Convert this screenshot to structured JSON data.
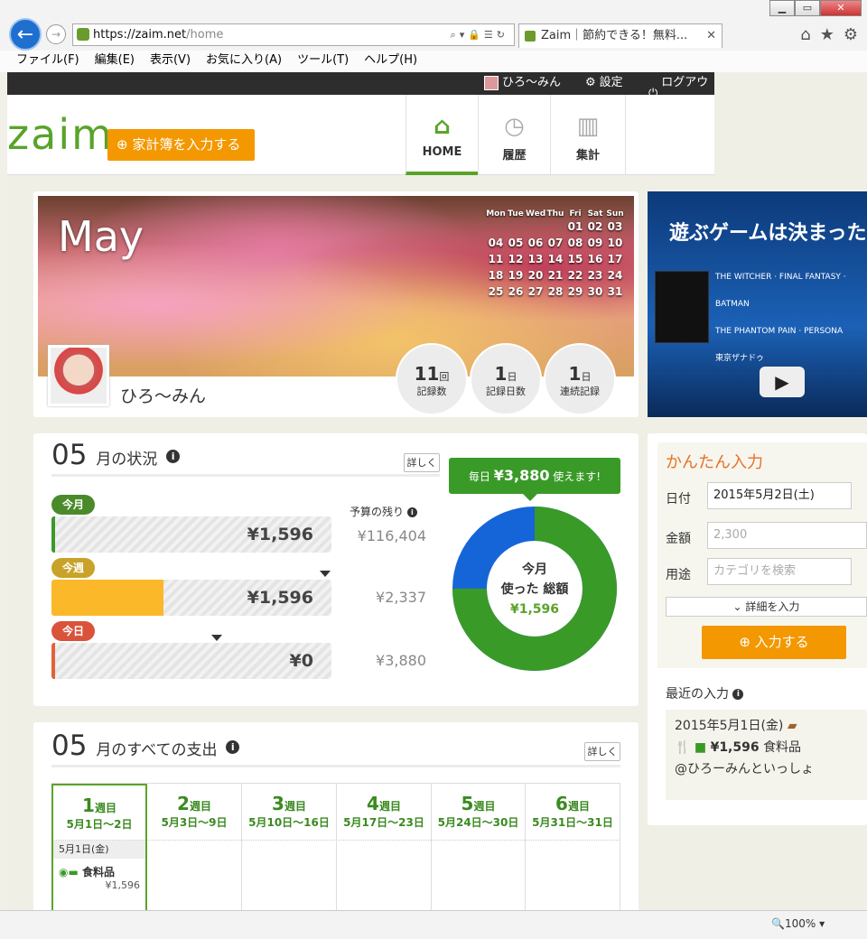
{
  "browser": {
    "url_host": "https://zaim.net",
    "url_path": "/home",
    "tab_title": "Zaim｜節約できる！無料...",
    "close_glyph": "✕",
    "menu": [
      "ファイル(F)",
      "編集(E)",
      "表示(V)",
      "お気に入り(A)",
      "ツール(T)",
      "ヘルプ(H)"
    ],
    "zoom": "100%"
  },
  "topbar": {
    "user": "ひろ〜みん",
    "settings": "設定",
    "logout": "ログアウト"
  },
  "header": {
    "logo": "zaim",
    "input_button": "家計簿を入力する",
    "nav": [
      {
        "label": "HOME",
        "icon": "home-icon",
        "active": true
      },
      {
        "label": "履歴",
        "icon": "clock-icon"
      },
      {
        "label": "集計",
        "icon": "chart-icon"
      }
    ]
  },
  "profile": {
    "month": "May",
    "username": "ひろ〜みん",
    "calendar": {
      "days": [
        "Mon",
        "Tue",
        "Wed",
        "Thu",
        "Fri",
        "Sat",
        "Sun"
      ],
      "weeks": [
        [
          "",
          "",
          "",
          "",
          "01",
          "02",
          "03"
        ],
        [
          "04",
          "05",
          "06",
          "07",
          "08",
          "09",
          "10"
        ],
        [
          "11",
          "12",
          "13",
          "14",
          "15",
          "16",
          "17"
        ],
        [
          "18",
          "19",
          "20",
          "21",
          "22",
          "23",
          "24"
        ],
        [
          "25",
          "26",
          "27",
          "28",
          "29",
          "30",
          "31"
        ]
      ]
    },
    "stats": [
      {
        "value": "11",
        "unit": "回",
        "label": "記録数"
      },
      {
        "value": "1",
        "unit": "日",
        "label": "記録日数"
      },
      {
        "value": "1",
        "unit": "日",
        "label": "連続記録"
      }
    ]
  },
  "ad": {
    "headline": "遊ぶゲームは決まった",
    "logos": [
      "THE WITCHER",
      "FINAL FANTASY",
      "BATMAN",
      "THE PHANTOM PAIN",
      "PERSONA",
      "東京ザナドゥ"
    ]
  },
  "status": {
    "month_num": "05",
    "title": "月の状況",
    "detail": "詳しく",
    "budget_label": "予算の残り",
    "callout_prefix": "毎日",
    "callout_amount": "¥3,880",
    "callout_suffix": "使えます!",
    "bars": [
      {
        "pill": "今月",
        "value": "¥1,596",
        "remaining": "¥116,404",
        "fill": 0.012,
        "color": "#4a8a2a",
        "fillcolor": "#3a9a28"
      },
      {
        "pill": "今週",
        "value": "¥1,596",
        "remaining": "¥2,337",
        "fill": 0.4,
        "color": "#c9a22a",
        "fillcolor": "#fbb829"
      },
      {
        "pill": "今日",
        "value": "¥0",
        "remaining": "¥3,880",
        "fill": 0.01,
        "color": "#d9533a",
        "fillcolor": "#e0633a"
      }
    ],
    "donut": {
      "line1": "今月",
      "line2": "使った 総額",
      "amount": "¥1,596",
      "used_fraction": 0.75,
      "used_color": "#3a9a28",
      "other_color": "#1565d8"
    }
  },
  "monthly": {
    "month_num": "05",
    "title": "月のすべての支出",
    "detail": "詳しく",
    "weeks": [
      {
        "n": "1",
        "w": "週目",
        "range": "5月1日〜2日"
      },
      {
        "n": "2",
        "w": "週目",
        "range": "5月3日〜9日"
      },
      {
        "n": "3",
        "w": "週目",
        "range": "5月10日〜16日"
      },
      {
        "n": "4",
        "w": "週目",
        "range": "5月17日〜23日"
      },
      {
        "n": "5",
        "w": "週目",
        "range": "5月24日〜30日"
      },
      {
        "n": "6",
        "w": "週目",
        "range": "5月31日〜31日"
      }
    ],
    "entry": {
      "date": "5月1日(金)",
      "category": "食料品",
      "amount": "¥1,596"
    }
  },
  "quick": {
    "title": "かんたん入力",
    "date_label": "日付",
    "date_value": "2015年5月2日(土)",
    "amount_label": "金額",
    "amount_placeholder": "2,300",
    "purpose_label": "用途",
    "purpose_placeholder": "カテゴリを検索",
    "more": "詳細を入力",
    "submit": "入力する",
    "recent_title": "最近の入力",
    "recent_date": "2015年5月1日(金)",
    "recent_amount": "¥1,596",
    "recent_category": "食料品",
    "recent_note": "@ひろーみんといっしょ"
  }
}
